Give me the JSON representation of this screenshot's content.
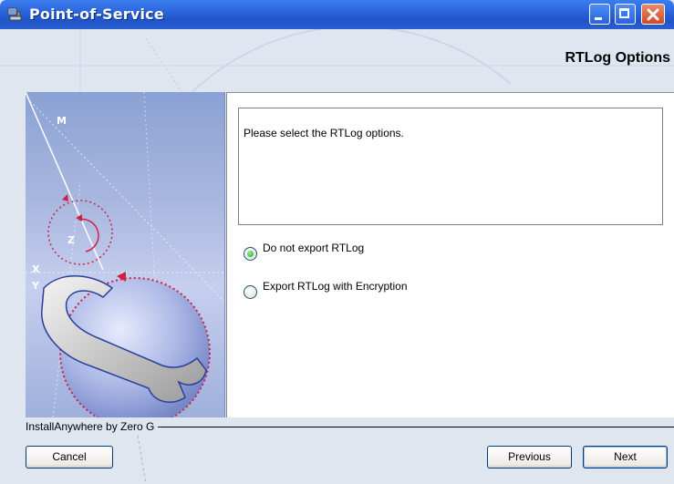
{
  "window": {
    "title": "Point-of-Service"
  },
  "header": {
    "title": "RTLog Options"
  },
  "message": {
    "text": "Please select the RTLog options."
  },
  "options": [
    {
      "label": "Do not export RTLog",
      "selected": true
    },
    {
      "label": "Export RTLog with Encryption",
      "selected": false
    }
  ],
  "footer": {
    "vendor_label": "InstallAnywhere by Zero G"
  },
  "buttons": {
    "cancel": "Cancel",
    "previous": "Previous",
    "next": "Next"
  },
  "colors": {
    "titlebar": "#2a62d9",
    "window_bg": "#dfe6f0",
    "radio_selected": "#2ca62a"
  },
  "image_panel": {
    "glyphs": [
      "M",
      "Z",
      "X",
      "Y"
    ]
  }
}
